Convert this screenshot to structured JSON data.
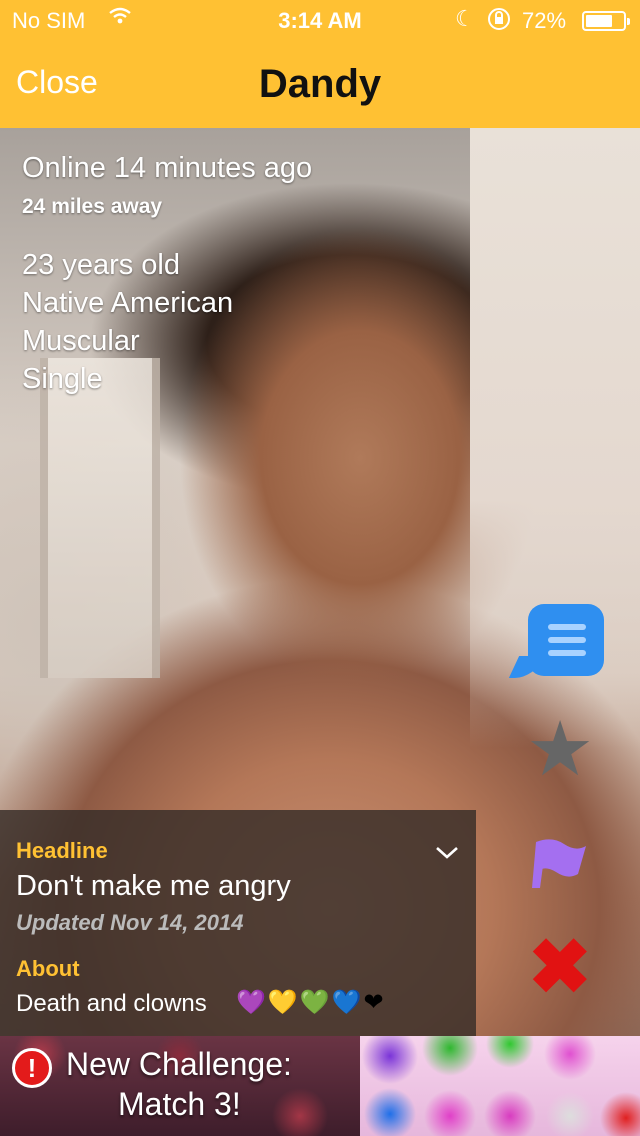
{
  "status_bar": {
    "carrier": "No SIM",
    "time": "3:14 AM",
    "battery": "72%",
    "battery_level": 0.72
  },
  "nav": {
    "close_label": "Close",
    "title": "Dandy"
  },
  "profile": {
    "online": "Online 14 minutes ago",
    "distance": "24 miles away",
    "stats": [
      "23 years old",
      "Native American",
      "Muscular",
      "Single"
    ]
  },
  "actions": {
    "chat_icon": "chat-bubble-icon",
    "favorite_icon": "star-icon",
    "report_icon": "flag-icon",
    "block_icon": "x-icon"
  },
  "panel": {
    "headline_label": "Headline",
    "headline": "Don't make me angry",
    "updated": "Updated Nov 14, 2014",
    "about_label": "About",
    "about": "Death and clowns",
    "about_emoji": "💜💛💚💙❤"
  },
  "ad": {
    "line1": "New Challenge:",
    "line2": "Match 3!",
    "alert_glyph": "!"
  },
  "colors": {
    "accent": "#ffc133",
    "chat_button": "#2f8ff0",
    "flag": "#a46ff0",
    "block": "#e11212"
  }
}
